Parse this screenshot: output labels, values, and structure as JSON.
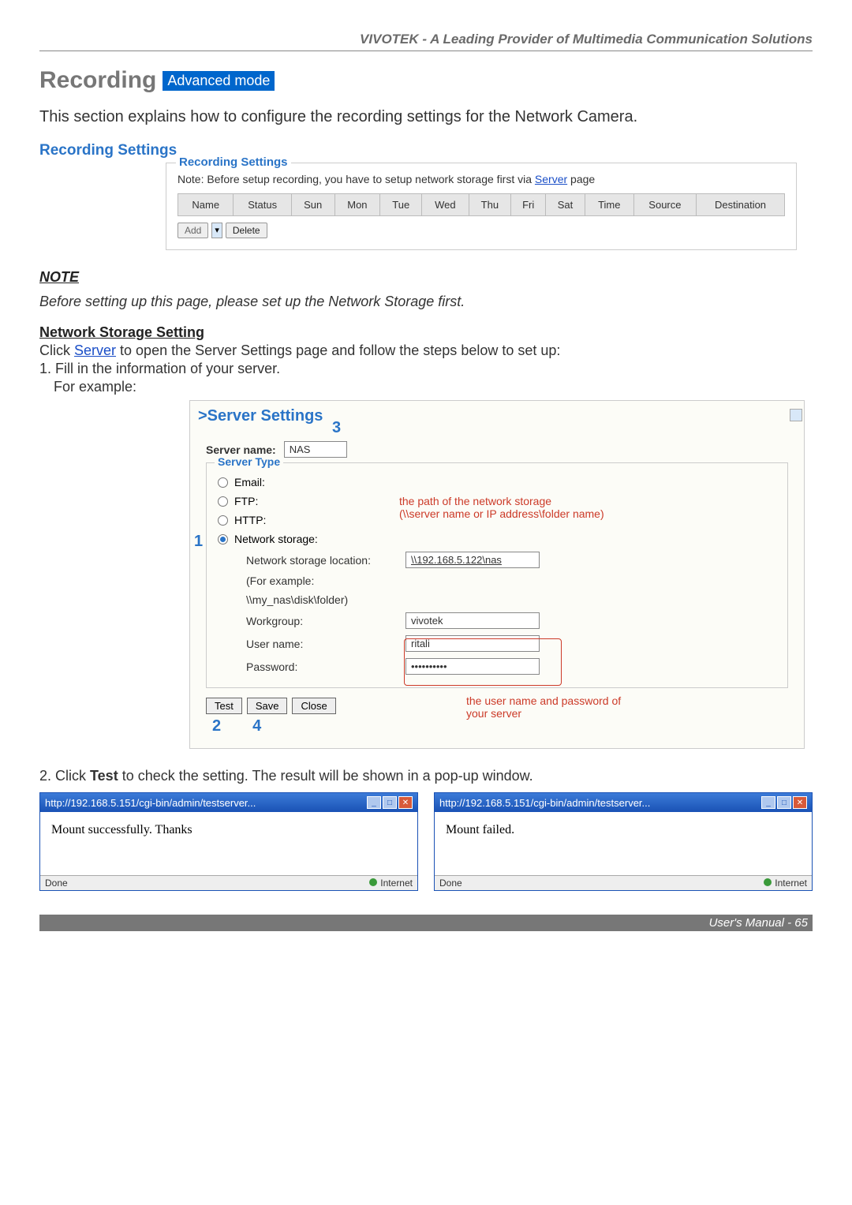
{
  "header": {
    "brand": "VIVOTEK - A Leading Provider of Multimedia Communication Solutions"
  },
  "title": {
    "main": "Recording",
    "badge": "Advanced mode"
  },
  "intro": "This section explains how to configure the recording settings for the Network Camera.",
  "recording_settings": {
    "heading": "Recording Settings",
    "legend": "Recording Settings",
    "note_prefix": "Note: Before setup recording, you have to setup network storage first via ",
    "note_link": "Server",
    "note_suffix": " page",
    "columns": [
      "Name",
      "Status",
      "Sun",
      "Mon",
      "Tue",
      "Wed",
      "Thu",
      "Fri",
      "Sat",
      "Time",
      "Source",
      "Destination"
    ],
    "buttons": {
      "add": "Add",
      "delete": "Delete"
    }
  },
  "note": {
    "title": "NOTE",
    "text": "Before setting up this page, please set up the Network Storage first."
  },
  "nss": {
    "title": "Network Storage Setting",
    "line1_pre": "Click ",
    "line1_link": "Server",
    "line1_post": " to open the Server Settings page and follow the steps below to set up:",
    "step1": "1. Fill in the information of your server.",
    "example": "For example:"
  },
  "server_settings": {
    "heading": ">Server Settings",
    "server_name_label": "Server name:",
    "server_name_value": "NAS",
    "server_type_legend": "Server Type",
    "options": {
      "email": "Email:",
      "ftp": "FTP:",
      "http": "HTTP:",
      "ns": "Network storage:"
    },
    "ns_location_label": "Network storage location:",
    "ns_location_value": "\\\\192.168.5.122\\nas",
    "ns_example1": "(For example:",
    "ns_example2": "\\\\my_nas\\disk\\folder)",
    "workgroup_label": "Workgroup:",
    "workgroup_value": "vivotek",
    "username_label": "User name:",
    "username_value": "ritali",
    "password_label": "Password:",
    "password_value": "••••••••••",
    "buttons": {
      "test": "Test",
      "save": "Save",
      "close": "Close"
    },
    "callouts": {
      "num1": "1",
      "num2": "2",
      "num3": "3",
      "num4": "4",
      "path_line1": "the path of the network storage",
      "path_line2": "(\\\\server name or IP address\\folder name)",
      "user_line1": "the user name and password of",
      "user_line2": "your server"
    }
  },
  "step2": {
    "prefix": "2. Click ",
    "bold": "Test",
    "suffix": " to check the setting. The result will be shown in a pop-up window."
  },
  "popups": {
    "url": "http://192.168.5.151/cgi-bin/admin/testserver...",
    "success": "Mount successfully. Thanks",
    "fail": "Mount failed.",
    "done": "Done",
    "internet": "Internet"
  },
  "footer": {
    "text": "User's Manual - 65"
  }
}
